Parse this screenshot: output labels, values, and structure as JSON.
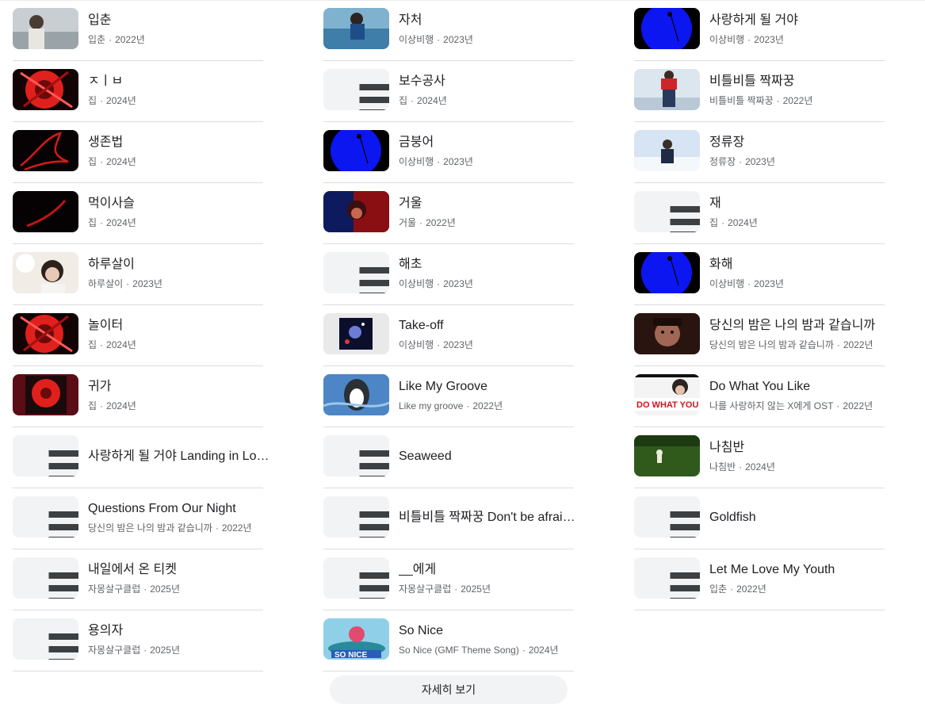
{
  "results": {
    "columns": [
      [
        {
          "title": "입춘",
          "subtitle": "입춘",
          "year": "2022년",
          "thumb": "photo-girl-sky",
          "has_thumb": true
        },
        {
          "title": "ㅈㅣㅂ",
          "subtitle": "집",
          "year": "2024년",
          "thumb": "red-flower",
          "has_thumb": true
        },
        {
          "title": "생존법",
          "subtitle": "집",
          "year": "2024년",
          "thumb": "red-scribble-dark",
          "has_thumb": true
        },
        {
          "title": "먹이사슬",
          "subtitle": "집",
          "year": "2024년",
          "thumb": "red-streak-dark",
          "has_thumb": true
        },
        {
          "title": "하루살이",
          "subtitle": "하루살이",
          "year": "2023년",
          "thumb": "photo-girl-light",
          "has_thumb": true
        },
        {
          "title": "놀이터",
          "subtitle": "집",
          "year": "2024년",
          "thumb": "red-flower",
          "has_thumb": true
        },
        {
          "title": "귀가",
          "subtitle": "집",
          "year": "2024년",
          "thumb": "red-album-maroon",
          "has_thumb": true
        },
        {
          "title": "사랑하게 될 거야 Landing in Love 가사",
          "subtitle": "",
          "year": "",
          "thumb": "lyrics-icon",
          "has_thumb": false
        },
        {
          "title": "Questions From Our Night",
          "subtitle": "당신의 밤은 나의 밤과 같습니까",
          "year": "2022년",
          "thumb": "lyrics-icon",
          "has_thumb": false
        },
        {
          "title": "내일에서 온 티켓",
          "subtitle": "자몽살구클럽",
          "year": "2025년",
          "thumb": "lyrics-icon",
          "has_thumb": false
        },
        {
          "title": "용의자",
          "subtitle": "자몽살구클럽",
          "year": "2025년",
          "thumb": "lyrics-icon",
          "has_thumb": false
        }
      ],
      [
        {
          "title": "자처",
          "subtitle": "이상비행",
          "year": "2023년",
          "thumb": "photo-sea",
          "has_thumb": true
        },
        {
          "title": "보수공사",
          "subtitle": "집",
          "year": "2024년",
          "thumb": "lyrics-icon",
          "has_thumb": false
        },
        {
          "title": "금붕어",
          "subtitle": "이상비행",
          "year": "2023년",
          "thumb": "blue-circle",
          "has_thumb": true
        },
        {
          "title": "거울",
          "subtitle": "거울",
          "year": "2022년",
          "thumb": "photo-red-blue",
          "has_thumb": true
        },
        {
          "title": "해초",
          "subtitle": "이상비행",
          "year": "2023년",
          "thumb": "lyrics-icon",
          "has_thumb": false
        },
        {
          "title": "Take-off",
          "subtitle": "이상비행",
          "year": "2023년",
          "thumb": "space-art",
          "has_thumb": true
        },
        {
          "title": "Like My Groove",
          "subtitle": "Like my groove",
          "year": "2022년",
          "thumb": "blue-cat",
          "has_thumb": true
        },
        {
          "title": "Seaweed",
          "subtitle": "",
          "year": "",
          "thumb": "lyrics-icon",
          "has_thumb": false
        },
        {
          "title": "비틀비틀 짝짜꿍 Don't be afraid 가사",
          "subtitle": "",
          "year": "",
          "thumb": "lyrics-icon",
          "has_thumb": false
        },
        {
          "title": "__에게",
          "subtitle": "자몽살구클럽",
          "year": "2025년",
          "thumb": "lyrics-icon",
          "has_thumb": false
        },
        {
          "title": "So Nice",
          "subtitle": "So Nice (GMF Theme Song)",
          "year": "2024년",
          "thumb": "so-nice",
          "has_thumb": true
        }
      ],
      [
        {
          "title": "사랑하게 될 거야",
          "subtitle": "이상비행",
          "year": "2023년",
          "thumb": "blue-circle",
          "has_thumb": true
        },
        {
          "title": "비틀비틀 짝짜꿍",
          "subtitle": "비틀비틀 짝짜꿍",
          "year": "2022년",
          "thumb": "photo-girl-sky-red",
          "has_thumb": true
        },
        {
          "title": "정류장",
          "subtitle": "정류장",
          "year": "2023년",
          "thumb": "photo-snow",
          "has_thumb": true
        },
        {
          "title": "재",
          "subtitle": "집",
          "year": "2024년",
          "thumb": "lyrics-icon",
          "has_thumb": false
        },
        {
          "title": "화해",
          "subtitle": "이상비행",
          "year": "2023년",
          "thumb": "blue-circle",
          "has_thumb": true
        },
        {
          "title": "당신의 밤은 나의 밤과 같습니까",
          "subtitle": "당신의 밤은 나의 밤과 같습니까",
          "year": "2022년",
          "thumb": "photo-face-dark",
          "has_thumb": true
        },
        {
          "title": "Do What You Like",
          "subtitle": "나를 사랑하지 않는 X에게 OST",
          "year": "2022년",
          "thumb": "dwyl",
          "has_thumb": true
        },
        {
          "title": "나침반",
          "subtitle": "나침반",
          "year": "2024년",
          "thumb": "photo-grass",
          "has_thumb": true
        },
        {
          "title": "Goldfish",
          "subtitle": "",
          "year": "",
          "thumb": "lyrics-icon",
          "has_thumb": false
        },
        {
          "title": "Let Me Love My Youth",
          "subtitle": "입춘",
          "year": "2022년",
          "thumb": "lyrics-icon",
          "has_thumb": false
        }
      ]
    ],
    "separator": "·"
  },
  "more_button": {
    "label": "자세히 보기"
  },
  "colors": {
    "title": "#202124",
    "meta": "#5f6368",
    "divider": "#dadce0",
    "placeholder_bg": "#f1f3f4",
    "accent_red": "#e0201c",
    "accent_blue": "#0b16f0"
  }
}
